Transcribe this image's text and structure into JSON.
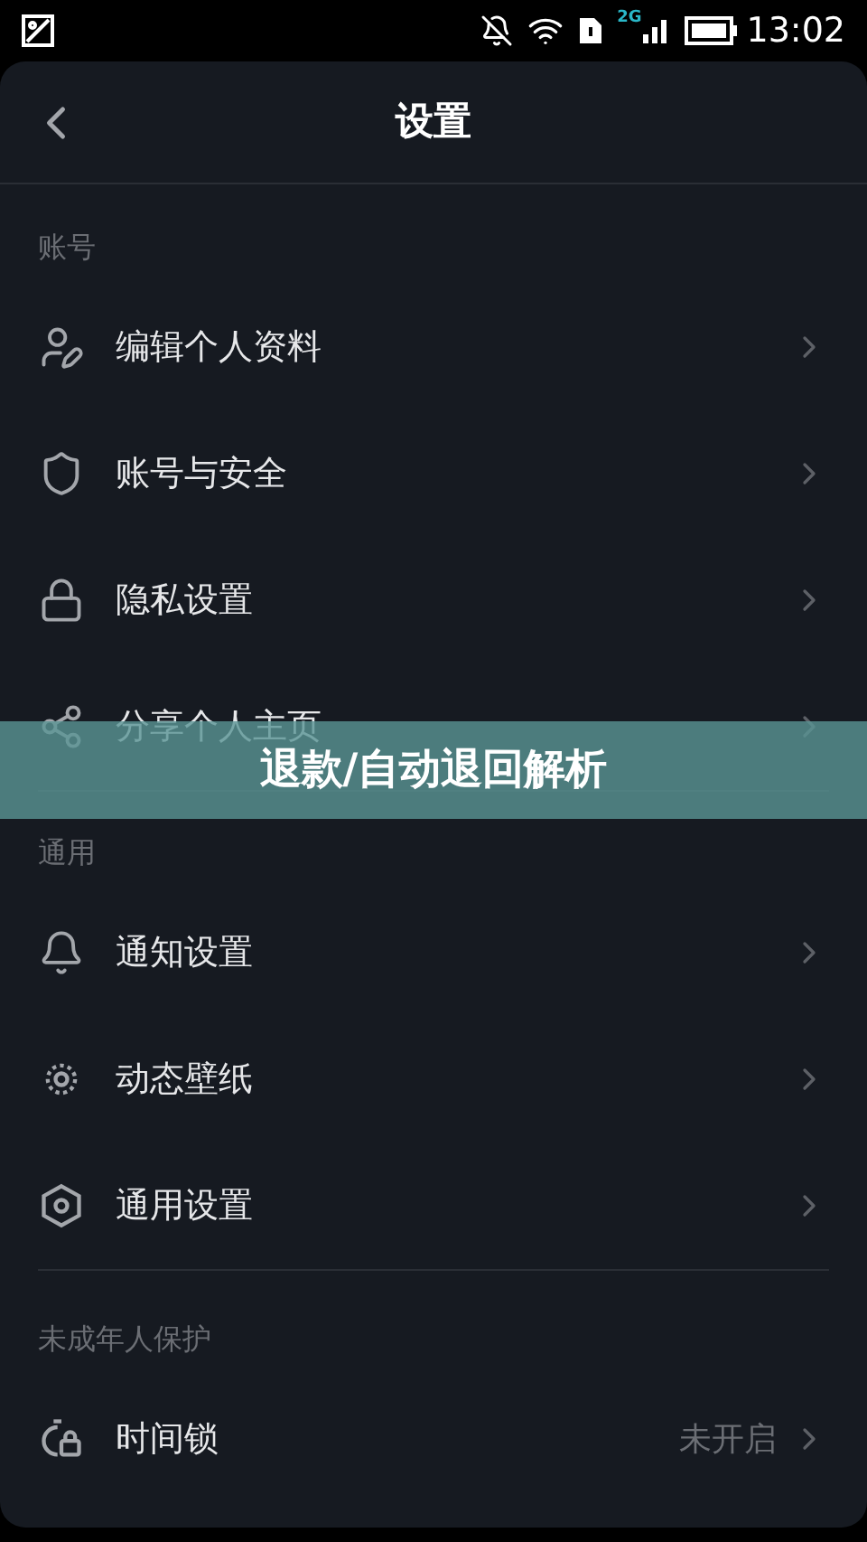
{
  "status_bar": {
    "network_type": "2G",
    "time": "13:02"
  },
  "header": {
    "title": "设置"
  },
  "sections": [
    {
      "title": "账号",
      "items": [
        {
          "label": "编辑个人资料"
        },
        {
          "label": "账号与安全"
        },
        {
          "label": "隐私设置"
        },
        {
          "label": "分享个人主页"
        }
      ]
    },
    {
      "title": "通用",
      "items": [
        {
          "label": "通知设置"
        },
        {
          "label": "动态壁纸"
        },
        {
          "label": "通用设置"
        }
      ]
    },
    {
      "title": "未成年人保护",
      "items": [
        {
          "label": "时间锁",
          "value": "未开启"
        }
      ]
    }
  ],
  "banner": {
    "text": "退款/自动退回解析"
  }
}
